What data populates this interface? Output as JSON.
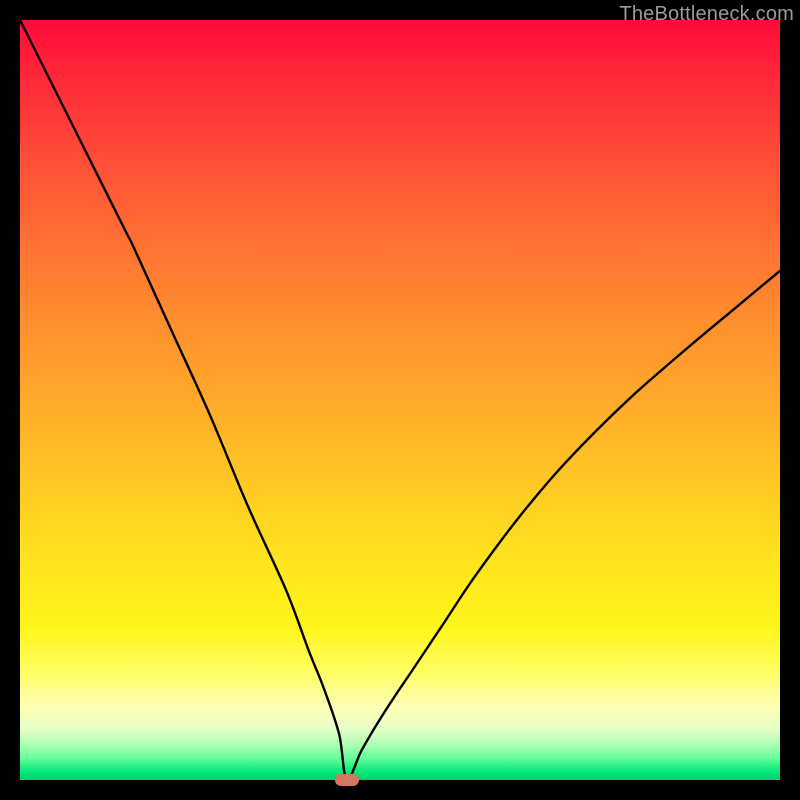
{
  "watermark": "TheBottleneck.com",
  "colors": {
    "curve": "#000000",
    "marker": "#d07860",
    "frame": "#000000"
  },
  "chart_data": {
    "type": "line",
    "title": "",
    "xlabel": "",
    "ylabel": "",
    "xlim": [
      0,
      100
    ],
    "ylim": [
      0,
      100
    ],
    "annotations": [
      {
        "name": "minimum-marker",
        "x": 43,
        "y": 0
      }
    ],
    "series": [
      {
        "name": "bottleneck-curve",
        "x": [
          0,
          5,
          10,
          14,
          15,
          20,
          25,
          30,
          35,
          38,
          40,
          42,
          43,
          45,
          48,
          52,
          56,
          60,
          66,
          72,
          80,
          88,
          94,
          100
        ],
        "values": [
          100,
          90,
          80,
          72,
          70,
          59,
          48,
          36,
          25,
          17,
          12,
          6,
          0,
          4,
          9,
          15,
          21,
          27,
          35,
          42,
          50,
          57,
          62,
          67
        ]
      }
    ]
  }
}
